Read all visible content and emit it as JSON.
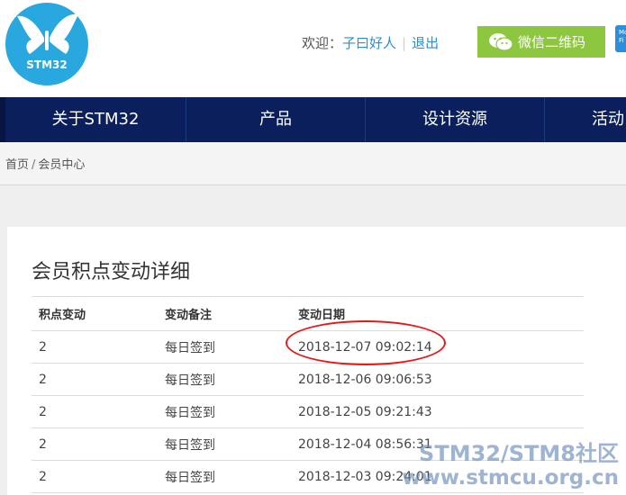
{
  "brand": {
    "logo_text": "STM32",
    "colors": {
      "logo_blue": "#29a8e0",
      "nav_bg": "#0b1f5c",
      "wechat_green": "#8dc63f",
      "link_blue": "#2a8fd6",
      "highlight_red": "#e41a1a"
    }
  },
  "header": {
    "welcome": "欢迎：",
    "username": "子曰好人",
    "logout": "退出",
    "wechat_button": "微信二维码",
    "app_badge": "Mo Fi"
  },
  "nav": {
    "items": [
      {
        "label": "关于STM32"
      },
      {
        "label": "产品"
      },
      {
        "label": "设计资源"
      },
      {
        "label": "活动"
      }
    ]
  },
  "breadcrumb": {
    "home": "首页",
    "separator": "/",
    "current": "会员中心"
  },
  "points": {
    "title": "会员积点变动详细",
    "columns": [
      "积点变动",
      "变动备注",
      "变动日期"
    ],
    "rows": [
      {
        "change": "2",
        "note": "每日签到",
        "date": "2018-12-07 09:02:14"
      },
      {
        "change": "2",
        "note": "每日签到",
        "date": "2018-12-06 09:06:53"
      },
      {
        "change": "2",
        "note": "每日签到",
        "date": "2018-12-05 09:21:43"
      },
      {
        "change": "2",
        "note": "每日签到",
        "date": "2018-12-04 08:56:31"
      },
      {
        "change": "2",
        "note": "每日签到",
        "date": "2018-12-03 09:24:01"
      }
    ]
  },
  "watermark": {
    "line1": "STM32/STM8社区",
    "line2": "www.stmcu.org.cn"
  },
  "icons": {
    "logo": "butterfly-icon",
    "wechat": "wechat-icon"
  }
}
